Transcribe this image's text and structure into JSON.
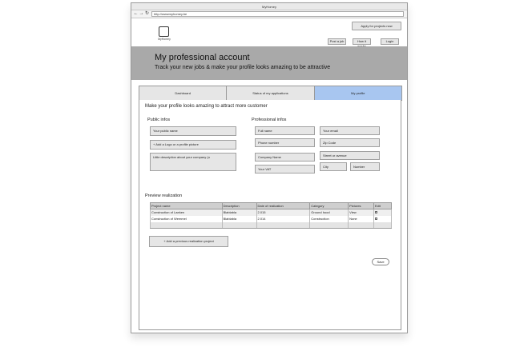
{
  "window": {
    "title": "MyHomey"
  },
  "navbar": {
    "url": "http://wwwmyhomey.be"
  },
  "header": {
    "logo_caption": "MyHomey",
    "apply_label": "Apply for projects now",
    "nav": [
      "Post a job",
      "How it works",
      "Login"
    ]
  },
  "hero": {
    "title": "My professional account",
    "subtitle": "Track your new jobs & make your profile looks amazing to be attractive"
  },
  "tabs": [
    "Dashboard",
    "Status of my applications",
    "My profile"
  ],
  "profile": {
    "heading": "Make your profile looks amazing to attract more customer",
    "public_title": "Public infos",
    "public_fields": [
      "Your public name",
      "+ Add a Logo or a profile picture",
      "Little description about your company (o"
    ],
    "pro_title": "Professional infos",
    "pro_fields": {
      "full_name": "Full name",
      "email": "Your email",
      "phone": "Phone number",
      "zip": "Zip Code",
      "company": "Company Name",
      "street": "Street or avenue",
      "vat": "Your VAT",
      "city": "City",
      "number": "Number"
    }
  },
  "realization": {
    "title": "Preview realization",
    "columns": [
      "Project name",
      "Description",
      "Date of realization",
      "Category",
      "Pictures",
      "Edit"
    ],
    "rows": [
      {
        "name": "Construction of Laeken",
        "description": "Blablabla",
        "date": "2.015",
        "category": "Ground hood",
        "pictures": "View"
      },
      {
        "name": "Construction of Wemmel",
        "description": "Blablabla",
        "date": "2.014",
        "category": "Construction",
        "pictures": "None"
      }
    ],
    "add_label": "+ Add a previous realization project",
    "save_label": "Save"
  }
}
